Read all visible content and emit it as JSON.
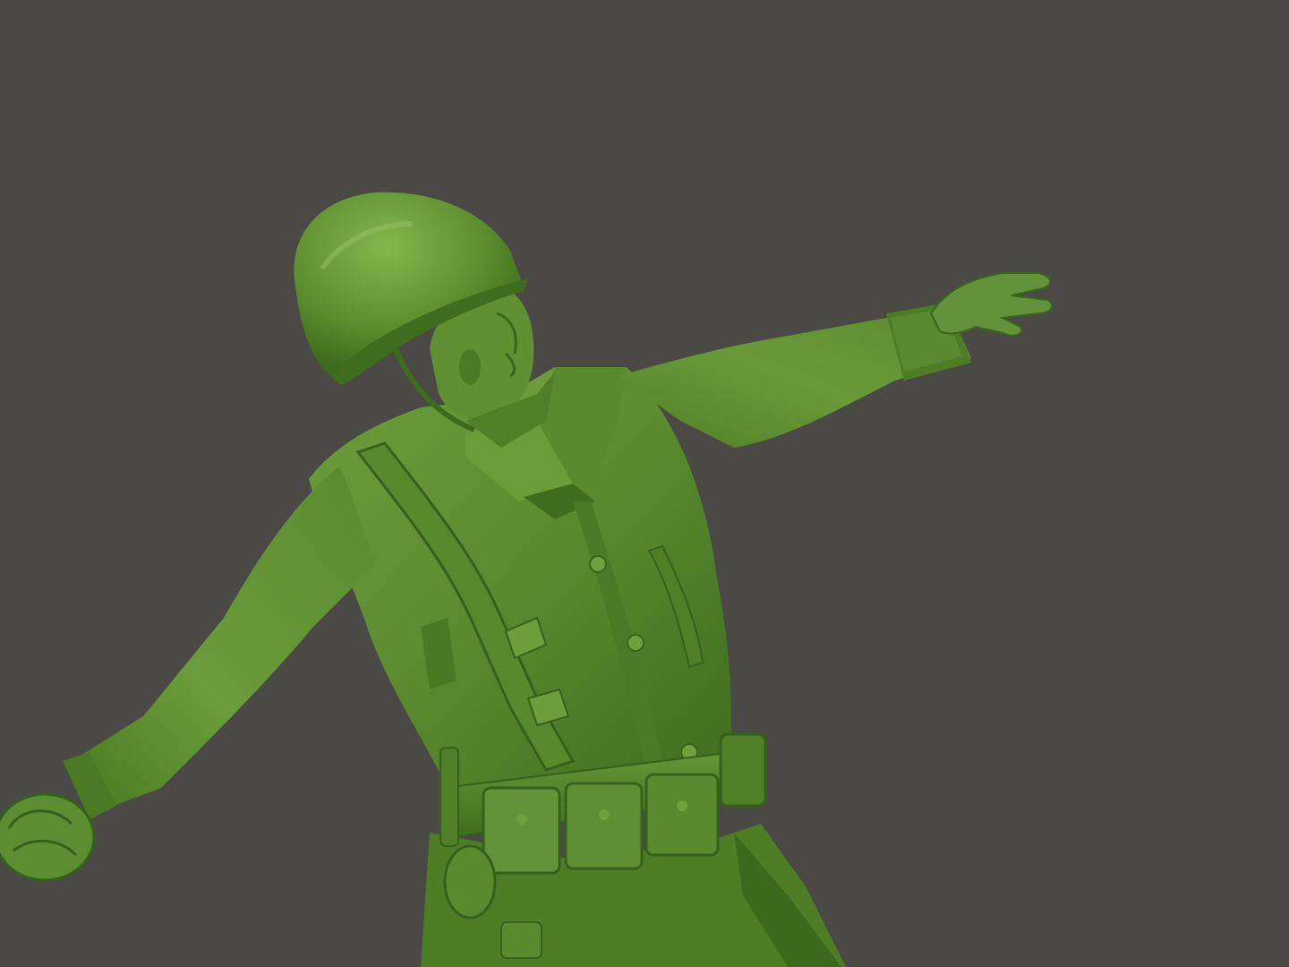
{
  "scene": {
    "background_color": "#4a4945",
    "subject": "green-plastic-toy-soldier-throwing-grenade",
    "colors": {
      "plastic_base": "#5a8a2e",
      "plastic_highlight": "#7fae4a",
      "plastic_shadow": "#3c6a1c",
      "plastic_deep_shadow": "#2e5414"
    }
  }
}
